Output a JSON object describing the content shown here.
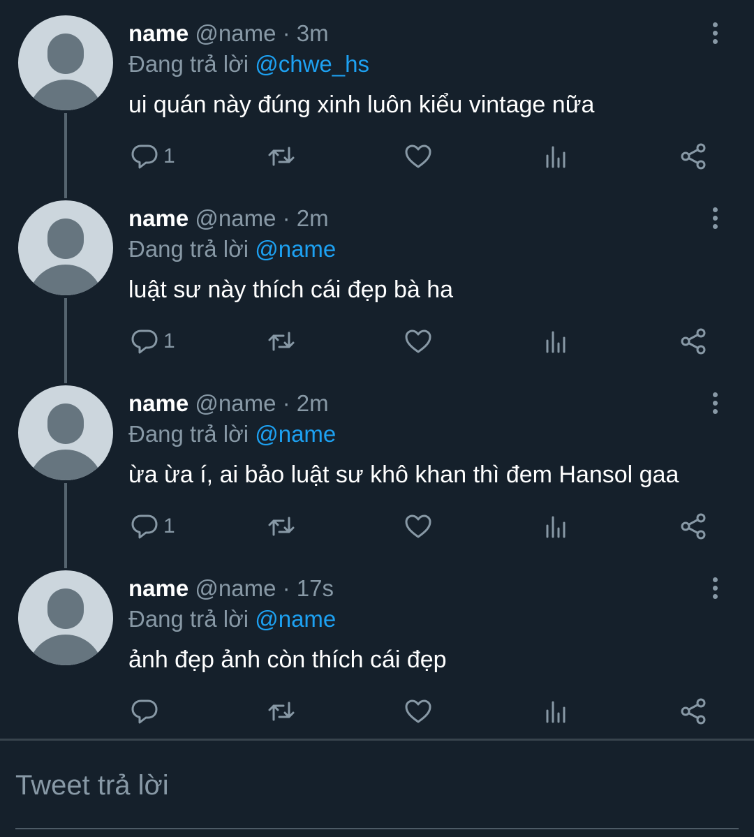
{
  "tweets": [
    {
      "display_name": "name",
      "handle": "@name",
      "separator": "·",
      "time": "3m",
      "reply_prefix": "Đang trả lời",
      "reply_to": "@chwe_hs",
      "text": "ui quán này đúng xinh luôn kiểu vintage nữa",
      "reply_count": "1",
      "has_connector": true
    },
    {
      "display_name": "name",
      "handle": "@name",
      "separator": "·",
      "time": "2m",
      "reply_prefix": "Đang trả lời",
      "reply_to": "@name",
      "text": "luật sư này thích cái đẹp bà ha",
      "reply_count": "1",
      "has_connector": true
    },
    {
      "display_name": "name",
      "handle": "@name",
      "separator": "·",
      "time": "2m",
      "reply_prefix": "Đang trả lời",
      "reply_to": "@name",
      "text": "ừa ừa í, ai bảo luật sư khô khan thì đem Hansol gaa",
      "reply_count": "1",
      "has_connector": true
    },
    {
      "display_name": "name",
      "handle": "@name",
      "separator": "·",
      "time": "17s",
      "reply_prefix": "Đang trả lời",
      "reply_to": "@name",
      "text": "ảnh đẹp ảnh còn thích cái đẹp",
      "reply_count": "",
      "has_connector": false
    }
  ],
  "icons": {
    "avatar": "default-avatar-icon",
    "more": "more-vertical-icon",
    "reply": "reply-icon",
    "retweet": "retweet-icon",
    "like": "heart-icon",
    "stats": "stats-icon",
    "share": "share-icon"
  },
  "compose": {
    "placeholder": "Tweet trả lời"
  },
  "colors": {
    "background": "#15202b",
    "text_primary": "#ffffff",
    "text_secondary": "#8899a6",
    "accent": "#1da1f2",
    "avatar_bg": "#ccd6dd",
    "avatar_fg": "#66757f"
  }
}
